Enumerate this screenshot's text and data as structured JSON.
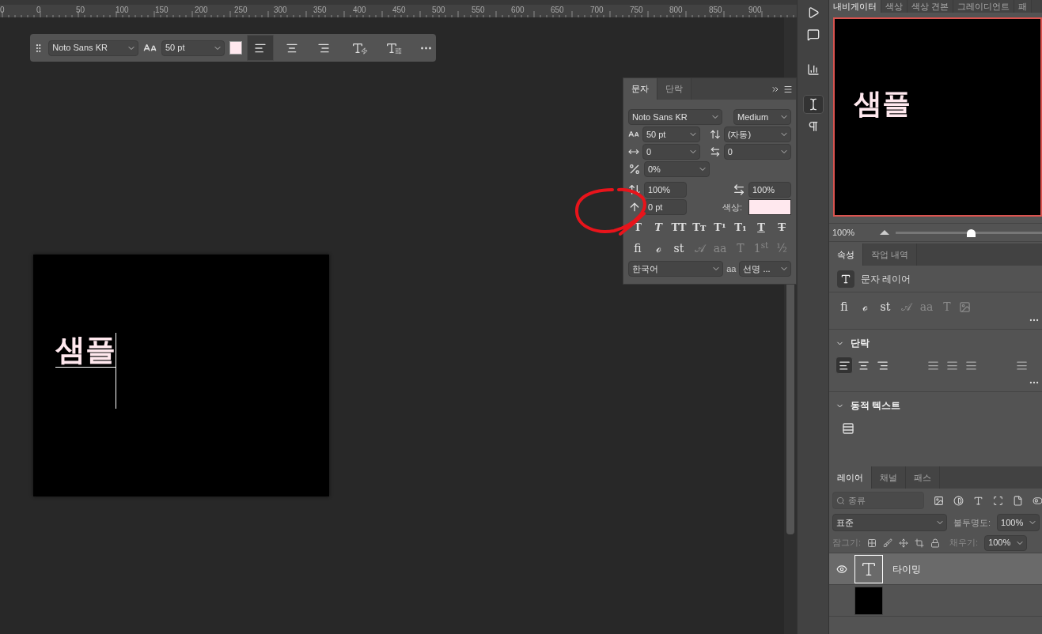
{
  "ruler": {
    "labels": [
      "0",
      "0",
      "50",
      "100",
      "150",
      "200",
      "250",
      "300",
      "350",
      "400",
      "450",
      "500",
      "550",
      "600",
      "650",
      "700",
      "750",
      "800",
      "850",
      "900"
    ]
  },
  "options_bar": {
    "font": "Noto Sans KR",
    "size": "50 pt",
    "color": "#ffe8ee",
    "align": [
      {
        "kind": "left",
        "selected": true
      },
      {
        "kind": "center",
        "selected": false
      },
      {
        "kind": "right",
        "selected": false
      }
    ]
  },
  "character_panel": {
    "tabs": [
      {
        "label": "문자",
        "selected": true
      },
      {
        "label": "단락",
        "selected": false
      }
    ],
    "font": "Noto Sans KR",
    "style": "Medium",
    "size": "50 pt",
    "leading": "(자동)",
    "kerning": "0",
    "tracking": "0",
    "tsume": "0%",
    "vscale": "100%",
    "hscale": "100%",
    "baseline": "0 pt",
    "color_label": "색상:",
    "color": "#ffe8ee",
    "style_buttons": [
      {
        "glyph": "T",
        "kind": "bold"
      },
      {
        "glyph": "T",
        "kind": "italic"
      },
      {
        "glyph": "TT",
        "kind": "plain"
      },
      {
        "glyph": "Tт",
        "kind": "plain"
      },
      {
        "glyph": "T¹",
        "kind": "plain"
      },
      {
        "glyph": "T₁",
        "kind": "plain"
      },
      {
        "glyph": "T",
        "kind": "underline"
      },
      {
        "glyph": "T",
        "kind": "strike"
      }
    ],
    "opentype_buttons": [
      {
        "glyph": "fi",
        "disabled": false
      },
      {
        "glyph": "ℴ",
        "disabled": false
      },
      {
        "glyph": "st",
        "disabled": false
      },
      {
        "glyph": "𝒜",
        "disabled": true
      },
      {
        "glyph": "aa",
        "disabled": true
      },
      {
        "glyph": "T",
        "disabled": true
      },
      {
        "glyph": "1$^{st}$",
        "disabled": true
      },
      {
        "glyph": "½",
        "disabled": true
      }
    ],
    "language": "한국어",
    "antialias_label": "aa",
    "antialias": "선명 ..."
  },
  "canvas": {
    "text": "샘플"
  },
  "dock_icons": [
    {
      "kind": "play",
      "selected": false
    },
    {
      "kind": "comment",
      "selected": false
    },
    {
      "kind": "histogram",
      "selected": false
    },
    {
      "kind": "character",
      "selected": true
    },
    {
      "kind": "paragraph",
      "selected": false
    }
  ],
  "navigator": {
    "tabs": [
      {
        "label": "내비게이터",
        "selected": true
      },
      {
        "label": "색상",
        "selected": false
      },
      {
        "label": "색상 견본",
        "selected": false
      },
      {
        "label": "그레이디언트",
        "selected": false
      },
      {
        "label": "패",
        "selected": false
      }
    ],
    "preview_text": "샘플",
    "zoom": "100%",
    "level": 0.5
  },
  "properties": {
    "tabs": [
      {
        "label": "속성",
        "selected": true
      },
      {
        "label": "작업 내역",
        "selected": false
      }
    ],
    "layer_type": "문자 레이어",
    "opentype_buttons": [
      {
        "glyph": "fi",
        "disabled": false
      },
      {
        "glyph": "ℴ",
        "disabled": false
      },
      {
        "glyph": "st",
        "disabled": false
      },
      {
        "glyph": "𝒜",
        "disabled": true
      },
      {
        "glyph": "aa",
        "disabled": true
      },
      {
        "glyph": "T",
        "disabled": true
      }
    ],
    "paragraph": {
      "title": "단락",
      "expanded": true,
      "align": [
        {
          "kind": "left",
          "selected": true
        },
        {
          "kind": "center",
          "selected": false
        },
        {
          "kind": "right",
          "selected": false
        },
        {
          "kind": "justify",
          "selected": false
        },
        {
          "kind": "justify",
          "selected": false
        },
        {
          "kind": "justify",
          "selected": false
        },
        {
          "kind": "justify",
          "selected": false
        }
      ]
    },
    "dynamic_text": {
      "title": "동적 텍스트",
      "expanded": true
    }
  },
  "layers": {
    "tabs": [
      {
        "label": "레이어",
        "selected": true
      },
      {
        "label": "채널",
        "selected": false
      },
      {
        "label": "패스",
        "selected": false
      }
    ],
    "filter_placeholder": "종류",
    "blend": "표준",
    "opacity_label": "불투명도:",
    "opacity": "100%",
    "lock_label": "잠그기:",
    "fill_label": "채우기:",
    "fill": "100%",
    "rows": [
      {
        "kind": "text",
        "name": "타이밍",
        "visible": true,
        "selected": true
      },
      {
        "kind": "image",
        "visible": false,
        "selected": false
      }
    ]
  }
}
